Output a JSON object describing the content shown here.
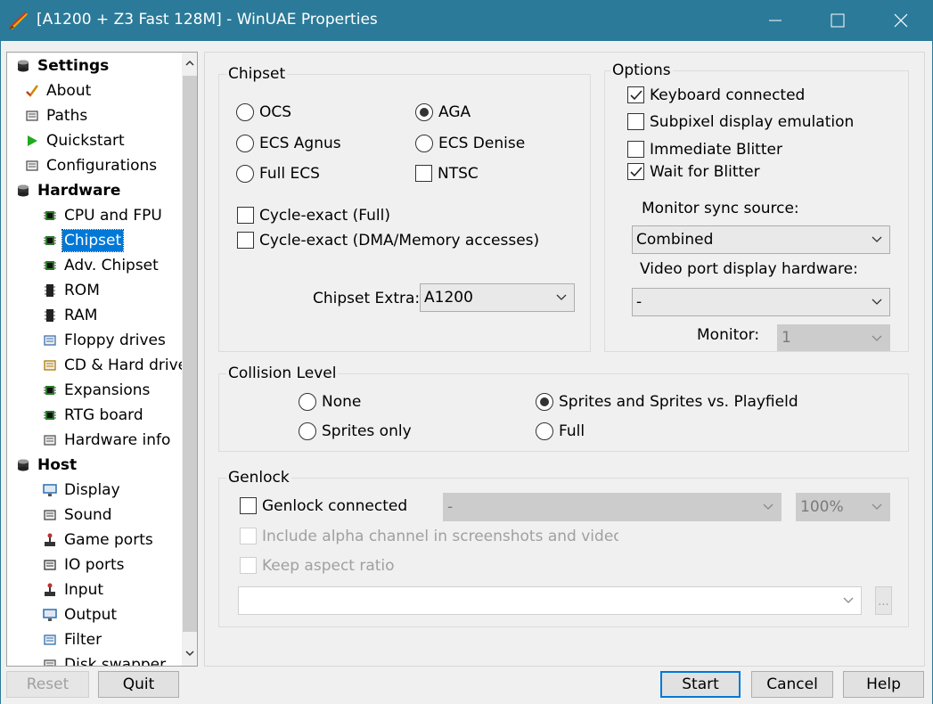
{
  "window": {
    "title": "[A1200 + Z3 Fast 128M] - WinUAE Properties"
  },
  "tree": [
    {
      "label": "Settings",
      "bold": true,
      "icon": "settings-icon"
    },
    {
      "label": "About",
      "icon": "checkmark-icon"
    },
    {
      "label": "Paths",
      "icon": "paths-icon"
    },
    {
      "label": "Quickstart",
      "icon": "play-icon"
    },
    {
      "label": "Configurations",
      "icon": "configurations-icon"
    },
    {
      "label": "Hardware",
      "bold": true,
      "icon": "hardware-icon"
    },
    {
      "label": "CPU and FPU",
      "icon": "chip-icon"
    },
    {
      "label": "Chipset",
      "icon": "chip-icon",
      "selected": true
    },
    {
      "label": "Adv. Chipset",
      "icon": "chip-icon"
    },
    {
      "label": "ROM",
      "icon": "rom-icon"
    },
    {
      "label": "RAM",
      "icon": "ram-icon"
    },
    {
      "label": "Floppy drives",
      "icon": "floppy-icon"
    },
    {
      "label": "CD & Hard drive",
      "icon": "harddrive-icon"
    },
    {
      "label": "Expansions",
      "icon": "expansion-card-icon"
    },
    {
      "label": "RTG board",
      "icon": "rtg-board-icon"
    },
    {
      "label": "Hardware info",
      "icon": "hardware-info-icon"
    },
    {
      "label": "Host",
      "bold": true,
      "icon": "host-icon"
    },
    {
      "label": "Display",
      "icon": "display-icon"
    },
    {
      "label": "Sound",
      "icon": "sound-icon"
    },
    {
      "label": "Game ports",
      "icon": "joystick-icon"
    },
    {
      "label": "IO ports",
      "icon": "io-ports-icon"
    },
    {
      "label": "Input",
      "icon": "input-icon"
    },
    {
      "label": "Output",
      "icon": "output-icon"
    },
    {
      "label": "Filter",
      "icon": "filter-icon"
    },
    {
      "label": "Disk swapper",
      "icon": "disk-swapper-icon"
    }
  ],
  "chipset": {
    "title": "Chipset",
    "ocs": "OCS",
    "aga": "AGA",
    "ecs_agnus": "ECS Agnus",
    "ecs_denise": "ECS Denise",
    "full_ecs": "Full ECS",
    "ntsc": "NTSC",
    "cycle_exact_full": "Cycle-exact (Full)",
    "cycle_exact_dma": "Cycle-exact (DMA/Memory accesses)",
    "extra_label": "Chipset Extra:",
    "extra_value": "A1200"
  },
  "options": {
    "title": "Options",
    "keyboard": "Keyboard connected",
    "subpixel": "Subpixel display emulation",
    "immediate_blitter": "Immediate Blitter",
    "wait_blitter": "Wait for Blitter",
    "sync_label": "Monitor sync source:",
    "sync_value": "Combined",
    "video_port_label": "Video port display hardware:",
    "video_port_value": "-",
    "monitor_label": "Monitor:",
    "monitor_value": "1"
  },
  "collision": {
    "title": "Collision Level",
    "none": "None",
    "sprites_only": "Sprites only",
    "sprites_playfield": "Sprites and Sprites vs. Playfield",
    "full": "Full"
  },
  "genlock": {
    "title": "Genlock",
    "connected": "Genlock connected",
    "mode_value": "-",
    "mix_value": "100%",
    "alpha": "Include alpha channel in screenshots and video ca",
    "aspect": "Keep aspect ratio",
    "file_value": "",
    "browse": "..."
  },
  "buttons": {
    "reset": "Reset",
    "quit": "Quit",
    "start": "Start",
    "cancel": "Cancel",
    "help": "Help"
  }
}
